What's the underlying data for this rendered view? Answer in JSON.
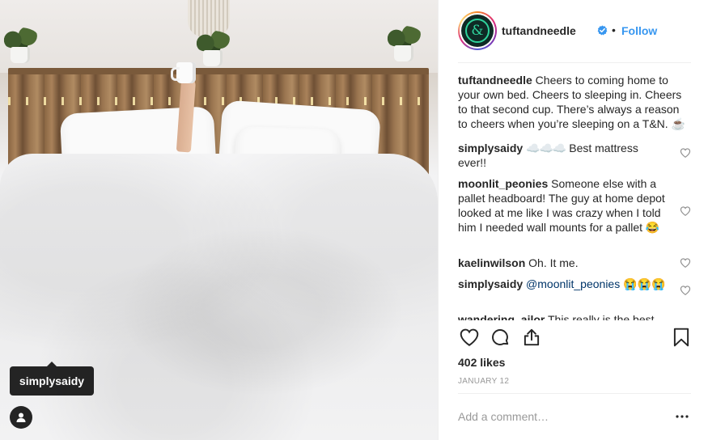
{
  "post": {
    "photo_alt": "",
    "tag": {
      "username": "simplysaidy"
    }
  },
  "header": {
    "username": "tuftandneedle",
    "avatar_letter": "&",
    "separator": "•",
    "follow_label": "Follow"
  },
  "caption": {
    "username": "tuftandneedle",
    "text": "Cheers to coming home to your own bed. Cheers to sleeping in. Cheers to that second cup. There’s always a reason to cheers when you’re sleeping on a T&N. ☕"
  },
  "comments": [
    {
      "username": "simplysaidy",
      "emoji": "☁️☁️☁️",
      "text": "Best mattress ever!!"
    },
    {
      "username": "moonlit_peonies",
      "text": "Someone else with a pallet headboard! The guy at home depot looked at me like I was crazy when I told him I needed wall mounts for a pallet 😂"
    },
    {
      "username": "kaelinwilson",
      "text": "Oh. It me."
    },
    {
      "username": "simplysaidy",
      "mention": "@moonlit_peonies",
      "text": "😭😭😭"
    },
    {
      "username": "wandering_ailor",
      "text": "This really is the best"
    }
  ],
  "stats": {
    "likes": "402 likes",
    "date": "JANUARY 12"
  },
  "comment_box": {
    "placeholder": "Add a comment…",
    "more_label": "•••"
  },
  "icons": {
    "like": "heart-icon",
    "comment": "comment-bubble-icon",
    "share": "share-icon",
    "save": "bookmark-icon",
    "verified": "verified-badge-icon",
    "tag_toggle": "user-tag-icon"
  },
  "colors": {
    "accent": "#3897f0",
    "text": "#262626",
    "muted": "#999999",
    "verified": "#3897f0",
    "avatar_bg": "#0f2a25",
    "avatar_logo": "#2fd39c"
  }
}
